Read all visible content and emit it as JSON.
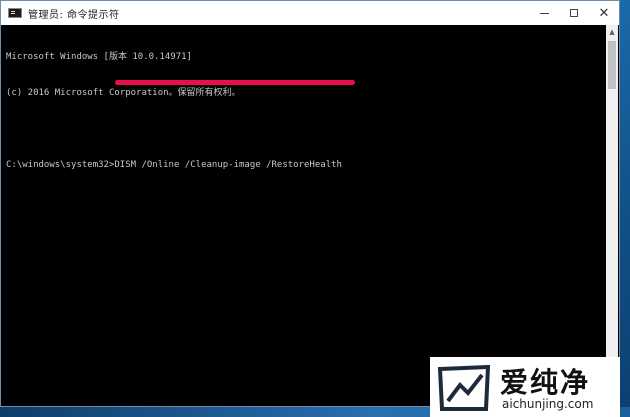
{
  "window": {
    "title": "管理员: 命令提示符",
    "minimize_label": "—",
    "maximize_label": "□",
    "close_label": "✕"
  },
  "console": {
    "lines": [
      "Microsoft Windows [版本 10.0.14971]",
      "(c) 2016 Microsoft Corporation。保留所有权利。",
      "",
      "C:\\windows\\system32>DISM /Online /Cleanup-image /RestoreHealth"
    ],
    "text_color": "#c8c8c8",
    "background": "#000000"
  },
  "highlight": {
    "color": "#e8104a"
  },
  "watermark": {
    "brand_cn": "爱纯净",
    "url": "aichunjing.com"
  },
  "icons": {
    "app": "console-icon",
    "scroll_up": "scroll-up-arrow-icon",
    "scroll_down": "scroll-down-arrow-icon"
  }
}
